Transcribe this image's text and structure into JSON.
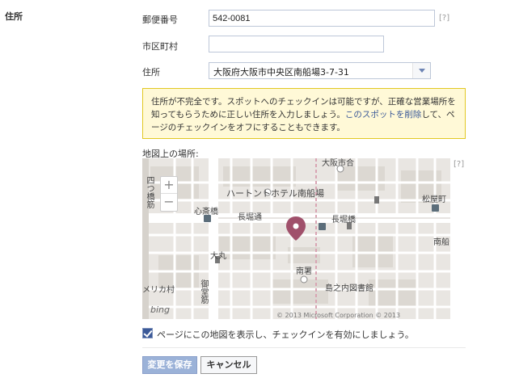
{
  "section": {
    "title": "住所"
  },
  "fields": {
    "postal": {
      "label": "郵便番号",
      "value": "542-0081",
      "help": "[?]"
    },
    "city": {
      "label": "市区町村",
      "value": ""
    },
    "address": {
      "label": "住所",
      "value": "大阪府大阪市中央区南船場3-7-31"
    }
  },
  "warning": {
    "text_before": "住所が不完全です。スポットへのチェックインは可能ですが、正確な営業場所を知ってもらうために正しい住所を入力しましょう。",
    "link": "このスポットを削除",
    "text_after": "して、ページのチェックインをオフにすることもできます。"
  },
  "map": {
    "label": "地図上の場所:",
    "help": "[?]",
    "zoom_in": "+",
    "zoom_out": "−",
    "labels": {
      "hotel": "ハートントホテル南船場",
      "osaka_kanpo": "大阪市合",
      "shinsaibashi": "心斎橋",
      "nagahoridori": "長堀通",
      "nagahoribashi": "長堀橋",
      "matsuyamachi": "松屋町",
      "daimaru": "大丸",
      "minamisho": "南署",
      "shimanouchi": "島之内図書館",
      "america_mura": "メリカ村",
      "midosuji": "御堂筋",
      "yotsuhashi": "四つ橋筋",
      "minamisen": "南船"
    },
    "bing": "bing",
    "copyright": "© 2013 Microsoft Corporation © 2013"
  },
  "checkin": {
    "checked": true,
    "label": "ページにこの地図を表示し、チェックインを有効にしましょう。"
  },
  "buttons": {
    "save": "変更を保存",
    "cancel": "キャンセル"
  }
}
